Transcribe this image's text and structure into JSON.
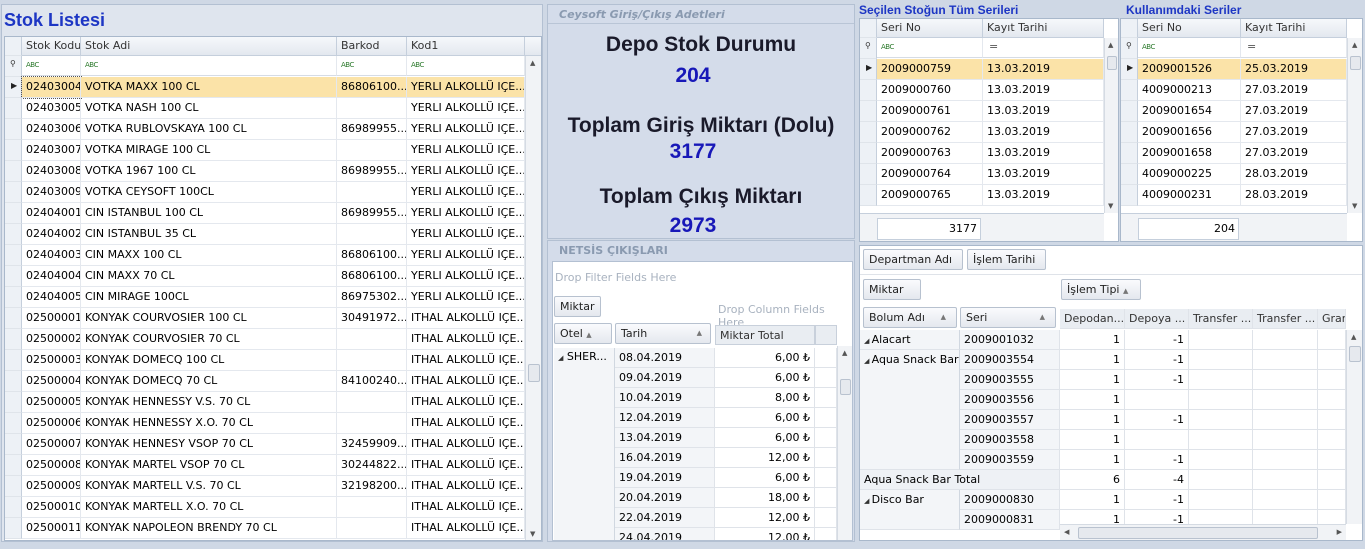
{
  "stock_list": {
    "title": "Stok Listesi",
    "columns": [
      "Stok Kodu",
      "Stok Adi",
      "Barkod",
      "Kod1"
    ],
    "rows": [
      [
        "02403004",
        "VOTKA MAXX 100 CL",
        "86806100...",
        "YERLI ALKOLLÜ IÇE..."
      ],
      [
        "02403005",
        "VOTKA NASH 100 CL",
        "",
        "YERLI ALKOLLÜ IÇE..."
      ],
      [
        "02403006",
        "VOTKA RUBLOVSKAYA 100 CL",
        "86989955...",
        "YERLI ALKOLLÜ IÇE..."
      ],
      [
        "02403007",
        "VOTKA MIRAGE 100 CL",
        "",
        "YERLI ALKOLLÜ IÇE..."
      ],
      [
        "02403008",
        "VOTKA 1967 100 CL",
        "86989955...",
        "YERLI ALKOLLÜ IÇE..."
      ],
      [
        "02403009",
        "VOTKA CEYSOFT 100CL",
        "",
        "YERLI ALKOLLÜ IÇE..."
      ],
      [
        "02404001",
        "CIN ISTANBUL 100 CL",
        "86989955...",
        "YERLI ALKOLLÜ IÇE..."
      ],
      [
        "02404002",
        "CIN ISTANBUL 35 CL",
        "",
        "YERLI ALKOLLÜ IÇE..."
      ],
      [
        "02404003",
        "CIN MAXX 100 CL",
        "86806100...",
        "YERLI ALKOLLÜ IÇE..."
      ],
      [
        "02404004",
        "CIN MAXX 70 CL",
        "86806100...",
        "YERLI ALKOLLÜ IÇE..."
      ],
      [
        "02404005",
        "CIN MIRAGE 100CL",
        "86975302...",
        "YERLI ALKOLLÜ IÇE..."
      ],
      [
        "02500001",
        "KONYAK COURVOSIER 100 CL",
        "30491972...",
        "ITHAL ALKOLLÜ IÇE..."
      ],
      [
        "02500002",
        "KONYAK COURVOSIER 70 CL",
        "",
        "ITHAL ALKOLLÜ IÇE..."
      ],
      [
        "02500003",
        "KONYAK DOMECQ 100 CL",
        "",
        "ITHAL ALKOLLÜ IÇE..."
      ],
      [
        "02500004",
        "KONYAK DOMECQ 70 CL",
        "84100240...",
        "ITHAL ALKOLLÜ IÇE..."
      ],
      [
        "02500005",
        "KONYAK HENNESSY V.S. 70 CL",
        "",
        "ITHAL ALKOLLÜ IÇE..."
      ],
      [
        "02500006",
        "KONYAK HENNESSY X.O. 70 CL",
        "",
        "ITHAL ALKOLLÜ IÇE..."
      ],
      [
        "02500007",
        "KONYAK HENNESY VSOP 70 CL",
        "32459909...",
        "ITHAL ALKOLLÜ IÇE..."
      ],
      [
        "02500008",
        "KONYAK MARTEL VSOP 70 CL",
        "30244822...",
        "ITHAL ALKOLLÜ IÇE..."
      ],
      [
        "02500009",
        "KONYAK MARTELL V.S. 70 CL",
        "32198200...",
        "ITHAL ALKOLLÜ IÇE..."
      ],
      [
        "02500010",
        "KONYAK MARTELL X.O. 70 CL",
        "",
        "ITHAL ALKOLLÜ IÇE..."
      ],
      [
        "02500011",
        "KONYAK NAPOLEON BRENDY 70 CL",
        "",
        "ITHAL ALKOLLÜ IÇE..."
      ]
    ]
  },
  "summary": {
    "group_title": "Ceysoft Giriş/Çıkış Adetleri",
    "depo_label": "Depo Stok Durumu",
    "depo_value": "204",
    "giris_label": "Toplam Giriş Miktarı (Dolu)",
    "giris_value": "3177",
    "cikis_label": "Toplam Çıkış Miktarı",
    "cikis_value": "2973"
  },
  "netsis": {
    "group_title": "NETSİS ÇIKIŞLARI",
    "filter_hint": "Drop Filter Fields Here",
    "data_field": "Miktar",
    "column_hint": "Drop Column Fields Here",
    "row_headers": [
      "Otel",
      "Tarih"
    ],
    "total_header": "Miktar Total",
    "group": "SHER...",
    "rows": [
      [
        "08.04.2019",
        "6,00 ₺"
      ],
      [
        "09.04.2019",
        "6,00 ₺"
      ],
      [
        "10.04.2019",
        "8,00 ₺"
      ],
      [
        "12.04.2019",
        "6,00 ₺"
      ],
      [
        "13.04.2019",
        "6,00 ₺"
      ],
      [
        "16.04.2019",
        "12,00 ₺"
      ],
      [
        "19.04.2019",
        "6,00 ₺"
      ],
      [
        "20.04.2019",
        "18,00 ₺"
      ],
      [
        "22.04.2019",
        "12,00 ₺"
      ],
      [
        "24.04.2019",
        "12,00 ₺"
      ]
    ]
  },
  "all_series": {
    "title": "Seçilen Stoğun Tüm Serileri",
    "columns": [
      "Seri No",
      "Kayıt Tarihi"
    ],
    "filter_date": "=",
    "rows": [
      [
        "2009000759",
        "13.03.2019"
      ],
      [
        "2009000760",
        "13.03.2019"
      ],
      [
        "2009000761",
        "13.03.2019"
      ],
      [
        "2009000762",
        "13.03.2019"
      ],
      [
        "2009000763",
        "13.03.2019"
      ],
      [
        "2009000764",
        "13.03.2019"
      ],
      [
        "2009000765",
        "13.03.2019"
      ]
    ],
    "total": "3177"
  },
  "used_series": {
    "title": "Kullanımdaki Seriler",
    "columns": [
      "Seri No",
      "Kayıt Tarihi"
    ],
    "filter_date": "=",
    "rows": [
      [
        "2009001526",
        "25.03.2019"
      ],
      [
        "4009000213",
        "27.03.2019"
      ],
      [
        "2009001654",
        "27.03.2019"
      ],
      [
        "2009001656",
        "27.03.2019"
      ],
      [
        "2009001658",
        "27.03.2019"
      ],
      [
        "4009000225",
        "28.03.2019"
      ],
      [
        "4009000231",
        "28.03.2019"
      ]
    ],
    "total": "204"
  },
  "dept_pivot": {
    "filter_fields": [
      "Departman Adı",
      "İşlem Tarihi"
    ],
    "data_field": "Miktar",
    "column_field": "İşlem Tipi",
    "row_headers": [
      "Bolum Adı",
      "Seri"
    ],
    "value_headers": [
      "Depodan...",
      "Depoya ...",
      "Transfer ...",
      "Transfer ...",
      "Gran"
    ],
    "rows": [
      {
        "group": "Alacart",
        "seri": "2009001032",
        "v1": "1",
        "v2": "-1"
      },
      {
        "group": "Aqua Snack Bar",
        "seri": "2009003554",
        "v1": "1",
        "v2": "-1"
      },
      {
        "group": "",
        "seri": "2009003555",
        "v1": "1",
        "v2": "-1"
      },
      {
        "group": "",
        "seri": "2009003556",
        "v1": "1",
        "v2": ""
      },
      {
        "group": "",
        "seri": "2009003557",
        "v1": "1",
        "v2": "-1"
      },
      {
        "group": "",
        "seri": "2009003558",
        "v1": "1",
        "v2": ""
      },
      {
        "group": "",
        "seri": "2009003559",
        "v1": "1",
        "v2": "-1"
      }
    ],
    "total_row": {
      "label": "Aqua Snack Bar Total",
      "v1": "6",
      "v2": "-4"
    },
    "after_rows": [
      {
        "group": "Disco Bar",
        "seri": "2009000830",
        "v1": "1",
        "v2": "-1"
      },
      {
        "group": "",
        "seri": "2009000831",
        "v1": "1",
        "v2": "-1"
      }
    ]
  },
  "colors": {
    "title_blue": "#1d36c4",
    "value_blue": "#1818b8",
    "selected_row": "#fbe3a8"
  }
}
